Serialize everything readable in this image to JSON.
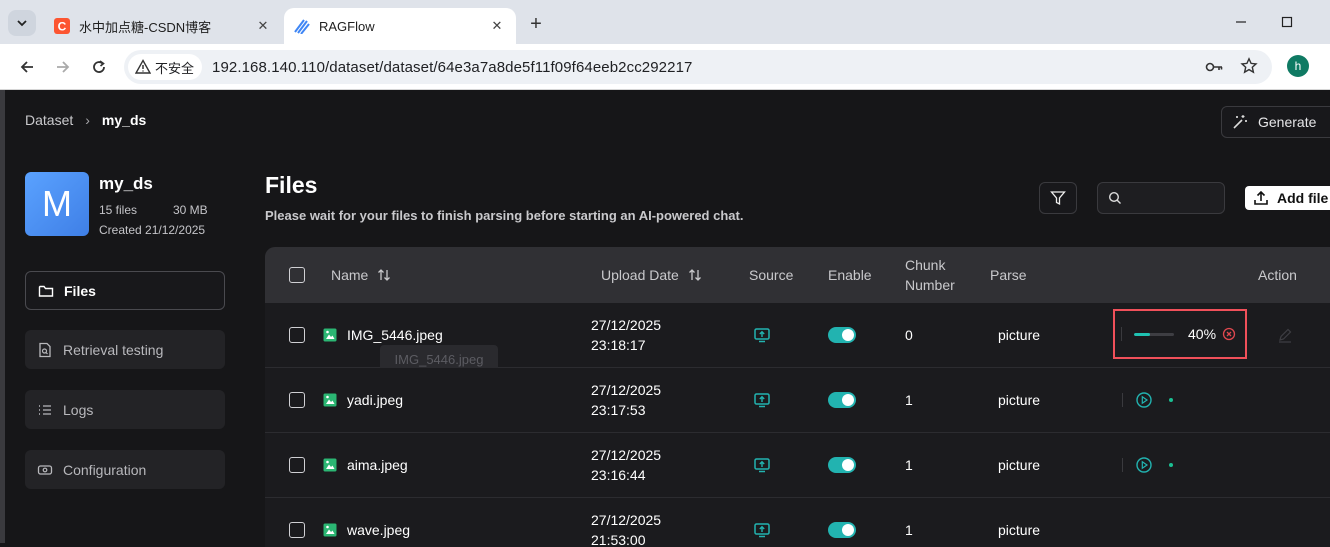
{
  "browser": {
    "tabs": [
      {
        "title": "水中加点糖-CSDN博客",
        "favicon": "csdn-icon",
        "active": false
      },
      {
        "title": "RAGFlow",
        "favicon": "ragflow-icon",
        "active": true
      }
    ],
    "security_label": "不安全",
    "url": "192.168.140.110/dataset/dataset/64e3a7a8de5f11f09f64eeb2cc292217",
    "profile_initial": "h"
  },
  "breadcrumb": {
    "root": "Dataset",
    "current": "my_ds"
  },
  "generate_label": "Generate",
  "dataset": {
    "avatar_letter": "M",
    "name": "my_ds",
    "file_count": "15 files",
    "size": "30 MB",
    "created": "Created 21/12/2025"
  },
  "sidebar": {
    "items": [
      {
        "label": "Files",
        "icon": "folder-icon",
        "active": true
      },
      {
        "label": "Retrieval testing",
        "icon": "retrieval-icon",
        "active": false
      },
      {
        "label": "Logs",
        "icon": "list-icon",
        "active": false
      },
      {
        "label": "Configuration",
        "icon": "settings-icon",
        "active": false
      }
    ]
  },
  "main": {
    "title": "Files",
    "subtitle": "Please wait for your files to finish parsing before starting an AI-powered chat.",
    "search_placeholder": "",
    "add_file_label": "Add file"
  },
  "table": {
    "columns": {
      "name": "Name",
      "upload_date": "Upload Date",
      "source": "Source",
      "enable": "Enable",
      "chunk_line1": "Chunk",
      "chunk_line2": "Number",
      "parse": "Parse",
      "action": "Action"
    },
    "tooltip": "IMG_5446.jpeg",
    "rows": [
      {
        "name": "IMG_5446.jpeg",
        "date": "27/12/2025",
        "time": "23:18:17",
        "enabled": true,
        "chunks": "0",
        "parser": "picture",
        "status": "parsing",
        "progress": 0.4,
        "progress_label": "40%"
      },
      {
        "name": "yadi.jpeg",
        "date": "27/12/2025",
        "time": "23:17:53",
        "enabled": true,
        "chunks": "1",
        "parser": "picture",
        "status": "done"
      },
      {
        "name": "aima.jpeg",
        "date": "27/12/2025",
        "time": "23:16:44",
        "enabled": true,
        "chunks": "1",
        "parser": "picture",
        "status": "done"
      },
      {
        "name": "wave.jpeg",
        "date": "27/12/2025",
        "time": "21:53:00",
        "enabled": true,
        "chunks": "1",
        "parser": "picture",
        "status": "done"
      }
    ]
  },
  "colors": {
    "accent_teal": "#22b3b0",
    "status_done": "#1bbf92",
    "highlight_red": "#f0505a",
    "cancel_red": "#e0484f"
  }
}
